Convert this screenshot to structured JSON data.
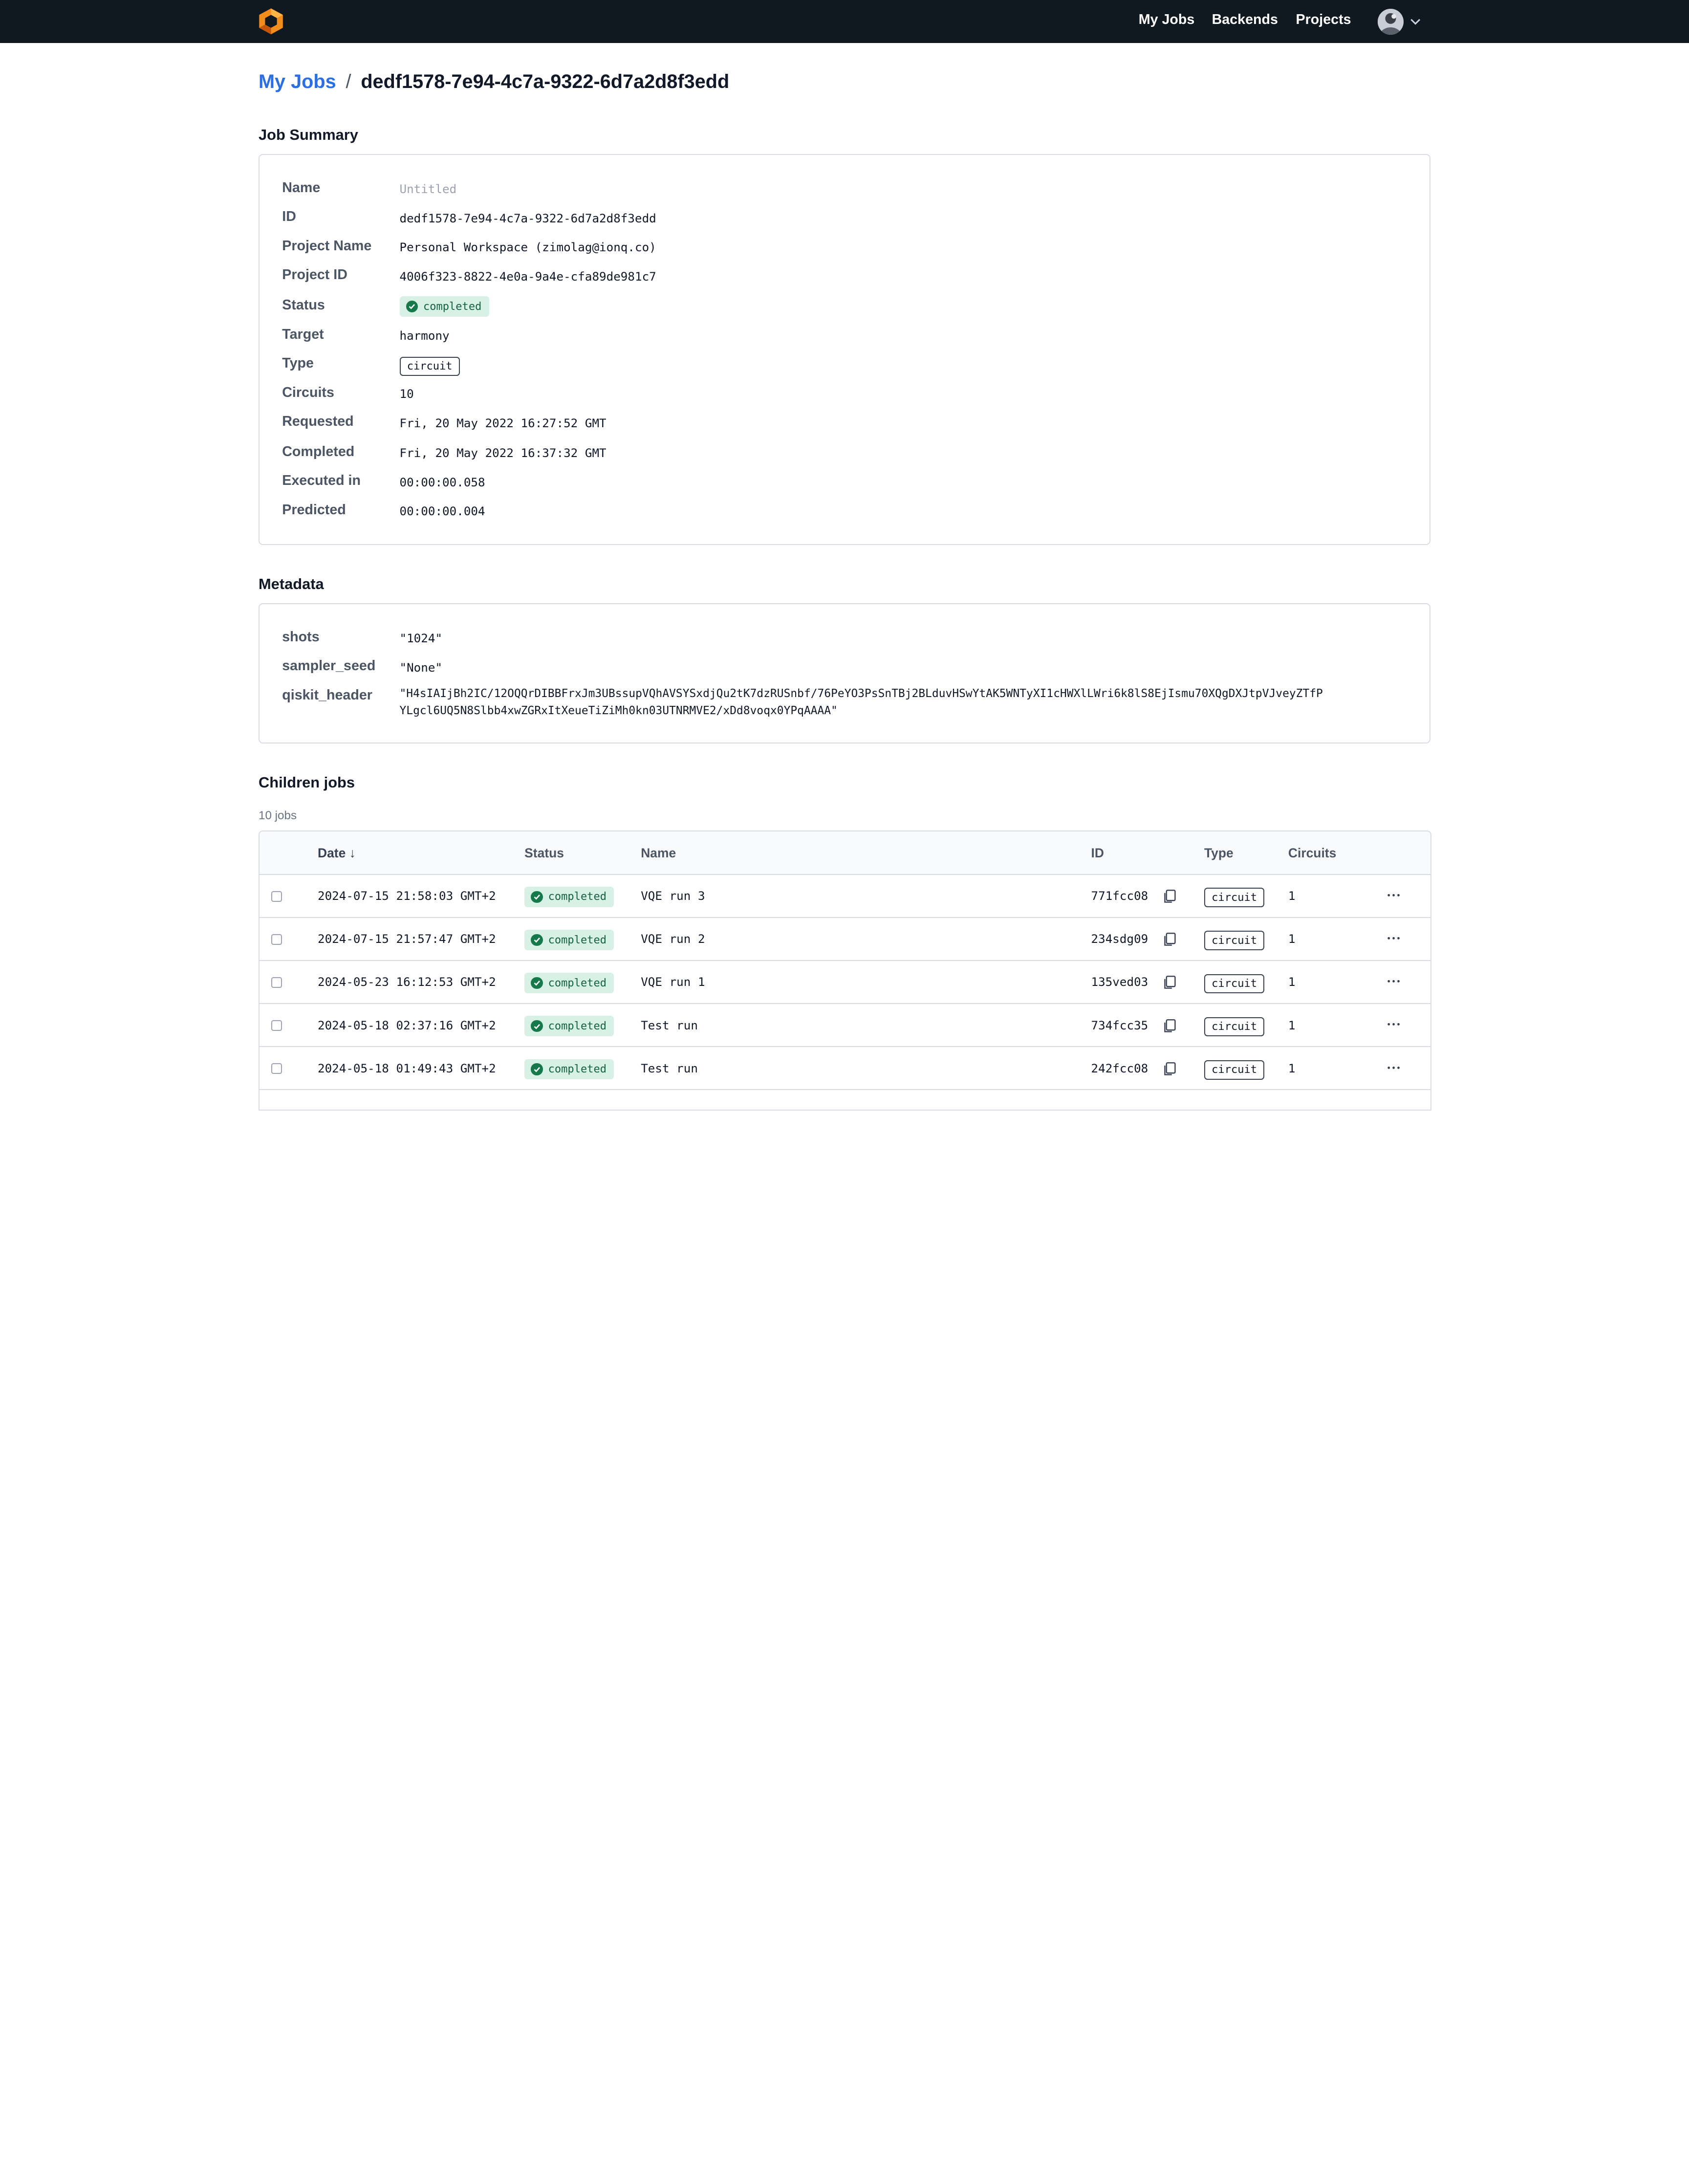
{
  "nav": {
    "links": [
      "My Jobs",
      "Backends",
      "Projects"
    ]
  },
  "breadcrumb": {
    "parent": "My Jobs",
    "separator": "/",
    "current": "dedf1578-7e94-4c7a-9322-6d7a2d8f3edd"
  },
  "summary": {
    "title": "Job Summary",
    "rows": [
      {
        "label": "Name",
        "value": "Untitled"
      },
      {
        "label": "ID",
        "value": "dedf1578-7e94-4c7a-9322-6d7a2d8f3edd"
      },
      {
        "label": "Project Name",
        "value": "Personal Workspace (zimolag@ionq.co)"
      },
      {
        "label": "Project ID",
        "value": "4006f323-8822-4e0a-9a4e-cfa89de981c7"
      },
      {
        "label": "Status",
        "value": "completed"
      },
      {
        "label": "Target",
        "value": "harmony"
      },
      {
        "label": "Type",
        "value": "circuit"
      },
      {
        "label": "Circuits",
        "value": "10"
      },
      {
        "label": "Requested",
        "value": "Fri, 20 May 2022 16:27:52 GMT"
      },
      {
        "label": "Completed",
        "value": "Fri, 20 May 2022 16:37:32 GMT"
      },
      {
        "label": "Executed in",
        "value": "00:00:00.058"
      },
      {
        "label": "Predicted",
        "value": "00:00:00.004"
      }
    ]
  },
  "metadata": {
    "title": "Metadata",
    "rows": [
      {
        "label": "shots",
        "value": "\"1024\""
      },
      {
        "label": "sampler_seed",
        "value": "\"None\""
      },
      {
        "label": "qiskit_header",
        "line1": "\"H4sIAIjBh2IC/12OQQrDIBBFrxJm3UBssupVQhAVSYSxdjQu2tK7dzRUSnbf/76PeYO3PsSnTBj2BLduvHSwYtAK5WNTyXI1cHWXlLWri6k8lS8EjIsmu70XQgDXJtpVJveyZTfP",
        "line2": "YLgcl6UQ5N8Slbb4xwZGRxItXeueTiZiMh0kn03UTNRMVE2/xDd8voqx0YPqAAAA\""
      }
    ]
  },
  "children": {
    "title": "Children jobs",
    "count": "10 jobs",
    "headers": {
      "date": "Date ↓",
      "status": "Status",
      "name": "Name",
      "id": "ID",
      "type": "Type",
      "circuits": "Circuits"
    },
    "rows": [
      {
        "date": "2024-07-15 21:58:03 GMT+2",
        "status": "completed",
        "name": "VQE run 3",
        "id": "771fcc08",
        "type": "circuit",
        "circuits": "1"
      },
      {
        "date": "2024-07-15 21:57:47 GMT+2",
        "status": "completed",
        "name": "VQE run 2",
        "id": "234sdg09",
        "type": "circuit",
        "circuits": "1"
      },
      {
        "date": "2024-05-23 16:12:53 GMT+2",
        "status": "completed",
        "name": "VQE run 1",
        "id": "135ved03",
        "type": "circuit",
        "circuits": "1"
      },
      {
        "date": "2024-05-18 02:37:16 GMT+2",
        "status": "completed",
        "name": "Test run",
        "id": "734fcc35",
        "type": "circuit",
        "circuits": "1"
      },
      {
        "date": "2024-05-18 01:49:43 GMT+2",
        "status": "completed",
        "name": "Test run",
        "id": "242fcc08",
        "type": "circuit",
        "circuits": "1"
      }
    ]
  },
  "icons": {
    "logo": "hexagon-logo-icon",
    "status": "check-circle-icon",
    "copy": "copy-icon",
    "more": "more-horizontal-icon",
    "menu": "chevron-down-icon"
  },
  "colors": {
    "topbar": "#101820",
    "link": "#2d6fe0",
    "status_bg": "#d8f1e6",
    "status_fg": "#16613f"
  }
}
